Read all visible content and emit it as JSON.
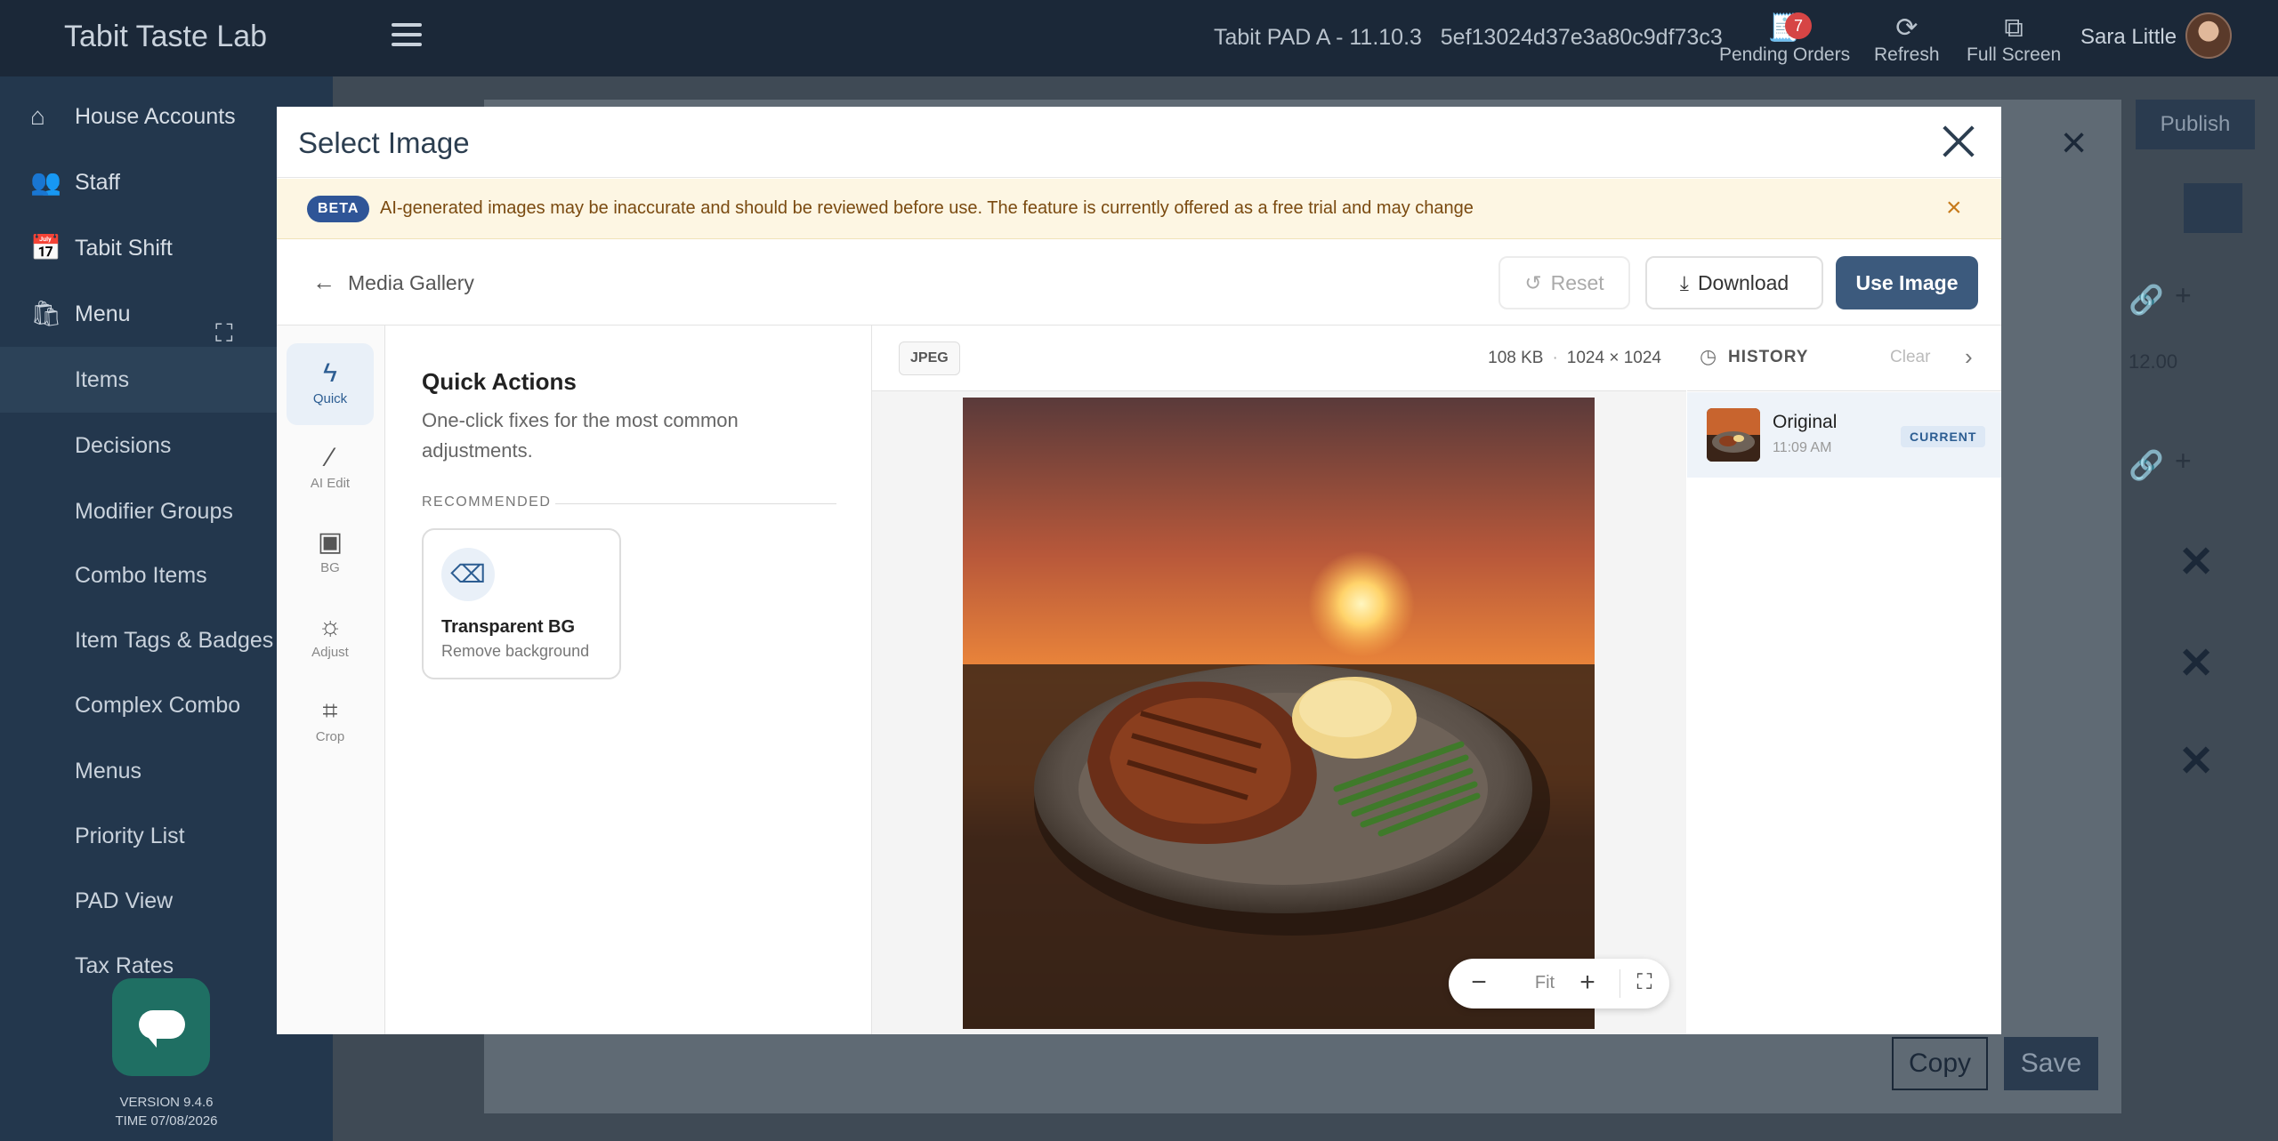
{
  "app": {
    "title": "Tabit Taste Lab",
    "device_info": "Tabit PAD A - 11.10.3   5ef13024d37e3a80c9df73c3",
    "actions": [
      {
        "label": "Pending Orders",
        "icon": "receipt-icon",
        "badge": "7"
      },
      {
        "label": "Refresh",
        "icon": "refresh-icon"
      },
      {
        "label": "Full Screen",
        "icon": "fullscreen-icon"
      }
    ],
    "user_name": "Sara Little"
  },
  "sidebar": {
    "items": [
      {
        "label": "House Accounts",
        "icon": "house-accounts-icon"
      },
      {
        "label": "Staff",
        "icon": "staff-icon"
      },
      {
        "label": "Tabit Shift",
        "icon": "calendar-icon"
      },
      {
        "label": "Menu",
        "icon": "menu-bag-icon"
      }
    ],
    "sub_items": [
      "Items",
      "Decisions",
      "Modifier Groups",
      "Combo Items",
      "Item Tags & Badges",
      "Complex Combo",
      "Menus",
      "Priority List",
      "PAD View",
      "Tax Rates"
    ],
    "version": "VERSION 9.4.6",
    "time": "TIME 07/08/2026"
  },
  "background_page": {
    "publish_label": "Publish",
    "price_value": "12.00",
    "copy_label": "Copy",
    "save_label": "Save"
  },
  "modal": {
    "title": "Select Image",
    "beta": {
      "pill": "BETA",
      "text": "AI-generated images may be inaccurate and should be reviewed before use. The feature is currently offered as a free trial and may change"
    },
    "toolbar": {
      "back_label": "Media Gallery",
      "reset_label": "Reset",
      "download_label": "Download",
      "use_label": "Use Image"
    },
    "rail": [
      {
        "label": "Quick",
        "icon": "lightning-icon",
        "active": true
      },
      {
        "label": "AI Edit",
        "icon": "magic-wand-icon"
      },
      {
        "label": "BG",
        "icon": "image-icon"
      },
      {
        "label": "Adjust",
        "icon": "sun-icon"
      },
      {
        "label": "Crop",
        "icon": "crop-icon"
      }
    ],
    "quick_actions": {
      "title": "Quick Actions",
      "description": "One-click fixes for the most common adjustments.",
      "section_label": "RECOMMENDED",
      "cards": [
        {
          "title": "Transparent BG",
          "subtitle": "Remove background",
          "icon": "eraser-icon"
        }
      ]
    },
    "preview": {
      "format": "JPEG",
      "size": "108 KB",
      "dimensions": "1024 × 1024",
      "zoom_label": "Fit"
    },
    "history": {
      "title": "HISTORY",
      "clear_label": "Clear",
      "entries": [
        {
          "name": "Original",
          "time": "11:09 AM",
          "tag": "CURRENT"
        }
      ]
    }
  }
}
